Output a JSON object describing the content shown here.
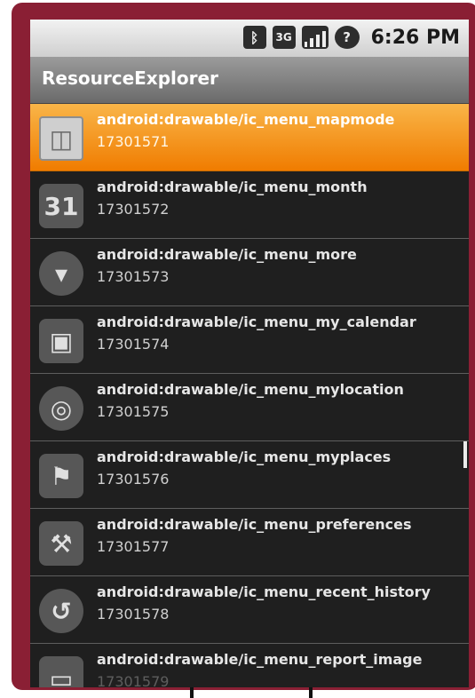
{
  "statusbar": {
    "icons": [
      "bluetooth-icon",
      "3g-icon",
      "signal-icon",
      "alarm-icon"
    ],
    "time": "6:26 PM"
  },
  "app": {
    "title": "ResourceExplorer"
  },
  "list": {
    "items": [
      {
        "name": "android:drawable/ic_menu_mapmode",
        "id": "17301571",
        "icon": "map-mode-icon",
        "selected": true
      },
      {
        "name": "android:drawable/ic_menu_month",
        "id": "17301572",
        "icon": "calendar-month-icon"
      },
      {
        "name": "android:drawable/ic_menu_more",
        "id": "17301573",
        "icon": "more-icon"
      },
      {
        "name": "android:drawable/ic_menu_my_calendar",
        "id": "17301574",
        "icon": "my-calendar-icon"
      },
      {
        "name": "android:drawable/ic_menu_mylocation",
        "id": "17301575",
        "icon": "my-location-icon"
      },
      {
        "name": "android:drawable/ic_menu_myplaces",
        "id": "17301576",
        "icon": "my-places-icon"
      },
      {
        "name": "android:drawable/ic_menu_preferences",
        "id": "17301577",
        "icon": "preferences-icon"
      },
      {
        "name": "android:drawable/ic_menu_recent_history",
        "id": "17301578",
        "icon": "recent-history-icon"
      },
      {
        "name": "android:drawable/ic_menu_report_image",
        "id": "17301579",
        "icon": "report-image-icon"
      }
    ]
  },
  "icon_glyphs": {
    "bluetooth": "ᛒ",
    "threeg": "3G",
    "alarm": "?",
    "mapmode": "◫",
    "month": "31",
    "more": "▾",
    "my_calendar": "▣",
    "mylocation": "◎",
    "myplaces": "⚑",
    "preferences": "⚒",
    "recent_history": "↺",
    "report_image": "▭"
  },
  "colors": {
    "selection": "#f39a1e",
    "frame": "#8a1f34",
    "list_bg": "#1f1f1f"
  }
}
